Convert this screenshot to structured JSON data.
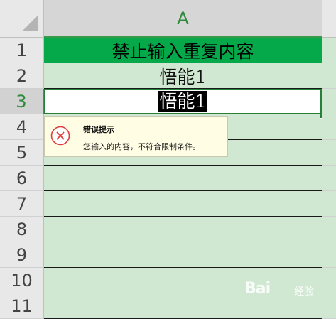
{
  "sheet": {
    "column_header": "A",
    "rows": [
      {
        "num": "1",
        "value": "禁止输入重复内容"
      },
      {
        "num": "2",
        "value": "悟能1"
      },
      {
        "num": "3",
        "value": "悟能1"
      },
      {
        "num": "4",
        "value": ""
      },
      {
        "num": "5",
        "value": ""
      },
      {
        "num": "6",
        "value": ""
      },
      {
        "num": "7",
        "value": ""
      },
      {
        "num": "8",
        "value": ""
      },
      {
        "num": "9",
        "value": ""
      },
      {
        "num": "10",
        "value": ""
      },
      {
        "num": "11",
        "value": ""
      }
    ]
  },
  "error_tooltip": {
    "title": "错误提示",
    "message": "您输入的内容，不符合限制条件。",
    "icon": "error-x-icon"
  },
  "watermark": {
    "brand": "Bai",
    "suffix": "经验"
  },
  "colors": {
    "header_fill": "#06a94a",
    "cell_fill": "#d0e8d2",
    "accent": "#2e8b3e",
    "error_red": "#e03b3b"
  }
}
